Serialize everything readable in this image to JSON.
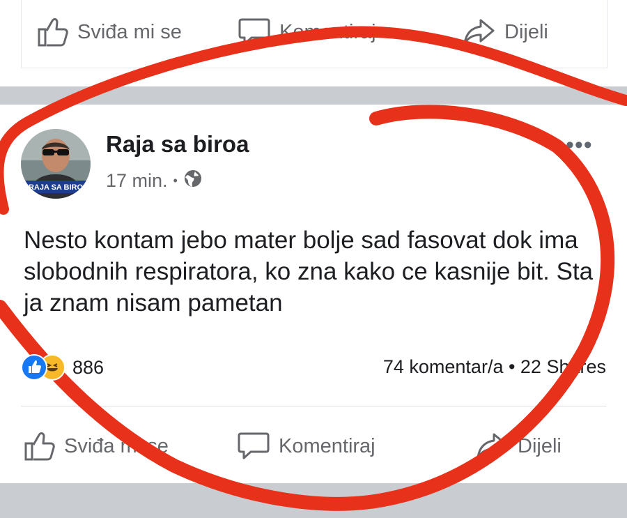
{
  "top_actions": {
    "like_label": "Sviđa mi se",
    "comment_label": "Komentiraj",
    "share_label": "Dijeli"
  },
  "post": {
    "author": "Raja sa biroa",
    "avatar_caption": "RAJA SA BIRO",
    "time": "17 min.",
    "separator": "•",
    "privacy_icon": "globe-icon",
    "text": "Nesto kontam jebo mater bolje sad fasovat dok ima slobodnih respiratora, ko zna kako ce kasnije bit. Sta ja znam nisam pametan",
    "more_icon": "•••",
    "reactions": {
      "icons": [
        "like-icon",
        "haha-icon"
      ],
      "count": "886"
    },
    "comments_shares": "74 komentar/a • 22 Shares"
  },
  "actions": {
    "like_label": "Sviđa mi se",
    "comment_label": "Komentiraj",
    "share_label": "Dijeli"
  },
  "colors": {
    "facebook_blue": "#1877f2",
    "text_secondary": "#65676b",
    "separator_band": "#c9ccd1",
    "annotation_red": "#e8311a"
  }
}
